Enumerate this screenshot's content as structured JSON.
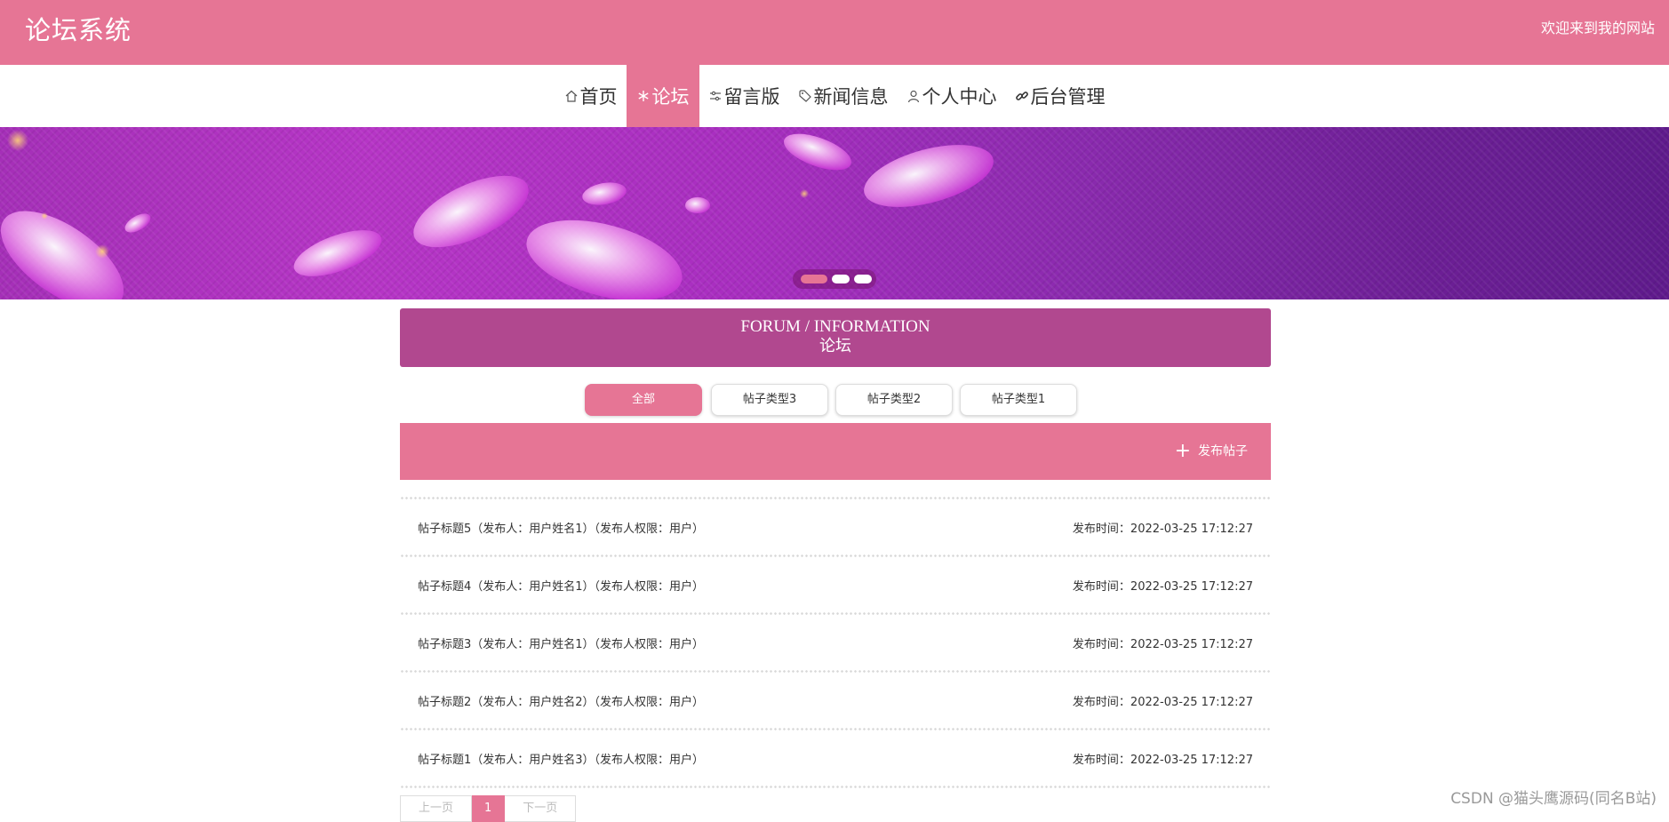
{
  "header": {
    "site_title": "论坛系统",
    "welcome": "欢迎来到我的网站"
  },
  "nav": {
    "items": [
      {
        "label": "首页",
        "icon": "home-icon"
      },
      {
        "label": "论坛",
        "icon": "snowflake-icon",
        "active": true
      },
      {
        "label": "留言版",
        "icon": "sliders-icon"
      },
      {
        "label": "新闻信息",
        "icon": "tag-icon"
      },
      {
        "label": "个人中心",
        "icon": "user-icon"
      },
      {
        "label": "后台管理",
        "icon": "link-icon"
      }
    ]
  },
  "banner": {
    "slides": 3,
    "active_slide": 1
  },
  "section": {
    "title_en": "FORUM / INFORMATION",
    "title_zh": "论坛"
  },
  "filters": {
    "items": [
      "全部",
      "帖子类型3",
      "帖子类型2",
      "帖子类型1"
    ],
    "active_index": 0
  },
  "actions": {
    "publish_label": "发布帖子",
    "publish_icon": "plus-icon"
  },
  "posts": [
    {
      "title": "帖子标题5（发布人：用户姓名1）（发布人权限：用户）",
      "time": "发布时间：2022-03-25 17:12:27"
    },
    {
      "title": "帖子标题4（发布人：用户姓名1）（发布人权限：用户）",
      "time": "发布时间：2022-03-25 17:12:27"
    },
    {
      "title": "帖子标题3（发布人：用户姓名1）（发布人权限：用户）",
      "time": "发布时间：2022-03-25 17:12:27"
    },
    {
      "title": "帖子标题2（发布人：用户姓名2）（发布人权限：用户）",
      "time": "发布时间：2022-03-25 17:12:27"
    },
    {
      "title": "帖子标题1（发布人：用户姓名3）（发布人权限：用户）",
      "time": "发布时间：2022-03-25 17:12:27"
    }
  ],
  "pagination": {
    "prev": "上一页",
    "current": "1",
    "next": "下一页"
  },
  "watermark": "CSDN @猫头鹰源码(同名B站)",
  "colors": {
    "primary": "#e67595",
    "section_header": "#b1488f",
    "banner_purple": "#8a2aae"
  }
}
